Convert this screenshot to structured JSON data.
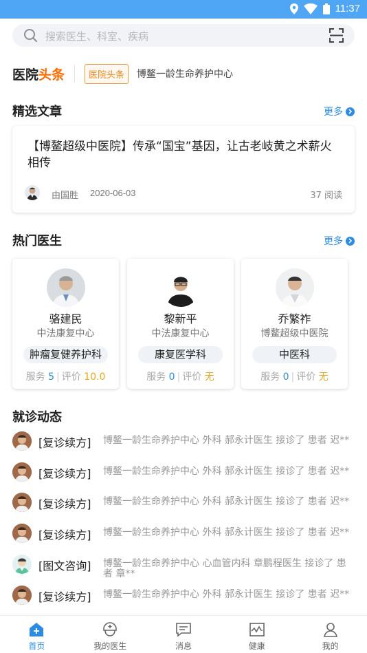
{
  "status_bar": {
    "time": "11:37"
  },
  "search": {
    "placeholder": "搜索医生、科室、疾病"
  },
  "news": {
    "logo_main": "医院",
    "logo_accent": "头条",
    "tag": "医院头条",
    "text": "博鳌一龄生命养护中心"
  },
  "featured": {
    "title": "精选文章",
    "more": "更多",
    "article": {
      "title": "【博鳌超级中医院】传承“国宝”基因，让古老岐黄之术薪火相传",
      "author": "由国胜",
      "date": "2020-06-03",
      "reads": "37 阅读"
    }
  },
  "doctors": {
    "title": "热门医生",
    "more": "更多",
    "stat_service": "服务",
    "stat_rating": "评价",
    "items": [
      {
        "name": "骆建民",
        "hospital": "中法康复中心",
        "dept": "肿瘤复健养护科",
        "service": "5",
        "rating": "10.0"
      },
      {
        "name": "黎新平",
        "hospital": "中法康复中心",
        "dept": "康复医学科",
        "service": "0",
        "rating": "无"
      },
      {
        "name": "乔繁祚",
        "hospital": "博鳌超级中医院",
        "dept": "中医科",
        "service": "0",
        "rating": "无"
      }
    ]
  },
  "activity": {
    "title": "就诊动态",
    "items": [
      {
        "type": "[复诊续方]",
        "text": "博鳌一龄生命养护中心 外科 郝永计医生 接诊了 患者 迟**"
      },
      {
        "type": "[复诊续方]",
        "text": "博鳌一龄生命养护中心 外科 郝永计医生 接诊了 患者 迟**"
      },
      {
        "type": "[复诊续方]",
        "text": "博鳌一龄生命养护中心 外科 郝永计医生 接诊了 患者 迟**"
      },
      {
        "type": "[复诊续方]",
        "text": "博鳌一龄生命养护中心 外科 郝永计医生 接诊了 患者 迟**"
      },
      {
        "type": "[图文咨询]",
        "text": "博鳌一龄生命养护中心 心血管内科 章鹏程医生 接诊了 患者 章**"
      },
      {
        "type": "[复诊续方]",
        "text": "博鳌一龄生命养护中心 外科 郝永计医生 接诊了 患者 迟**"
      }
    ]
  },
  "tabs": [
    {
      "label": "首页",
      "icon": "home-icon",
      "active": true
    },
    {
      "label": "我的医生",
      "icon": "doctor-icon",
      "active": false
    },
    {
      "label": "消息",
      "icon": "message-icon",
      "active": false
    },
    {
      "label": "健康",
      "icon": "health-icon",
      "active": false
    },
    {
      "label": "我的",
      "icon": "profile-icon",
      "active": false
    }
  ],
  "colors": {
    "primary": "#2b8ce6",
    "status_bar": "#4ea6f4",
    "accent_orange": "#f08a1e"
  }
}
